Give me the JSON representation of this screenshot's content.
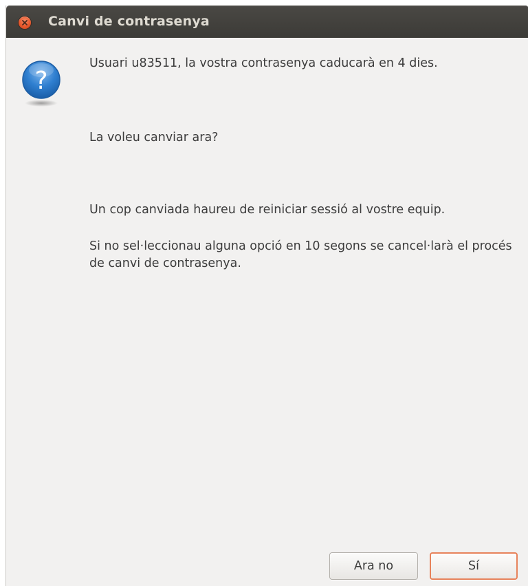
{
  "window": {
    "title": "Canvi de contrasenya"
  },
  "dialog": {
    "icon": "question-icon",
    "message_expiry": "Usuari u83511, la vostra contrasenya caducarà en 4 dies.",
    "question": "La voleu canviar ara?",
    "info_restart": "Un cop canviada haureu de reiniciar sessió al vostre equip.",
    "info_timeout": "Si no sel·leccionau alguna opció en 10 segons se cancel·larà el procés de canvi de contrasenya."
  },
  "buttons": {
    "no_label": "Ara no",
    "yes_label": "Sí"
  },
  "colors": {
    "titlebar": "#3c3b37",
    "close_button": "#e8582c",
    "dialog_background": "#f2f1f0",
    "default_button_border": "#e7825a",
    "question_icon": "#1f6fc1"
  }
}
